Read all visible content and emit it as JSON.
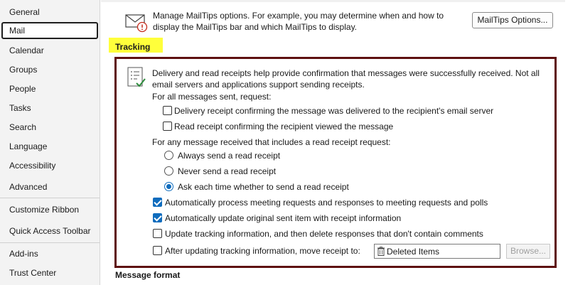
{
  "sidebar": {
    "items": [
      {
        "label": "General"
      },
      {
        "label": "Mail",
        "selected": true
      },
      {
        "label": "Calendar"
      },
      {
        "label": "Groups"
      },
      {
        "label": "People"
      },
      {
        "label": "Tasks"
      },
      {
        "label": "Search"
      },
      {
        "label": "Language"
      },
      {
        "label": "Accessibility"
      },
      {
        "label": "Advanced"
      },
      {
        "label": "Customize Ribbon"
      },
      {
        "label": "Quick Access Toolbar"
      },
      {
        "label": "Add-ins"
      },
      {
        "label": "Trust Center"
      }
    ]
  },
  "mailtips": {
    "icon": "envelope-warning-icon",
    "text": "Manage MailTips options. For example, you may determine when and how to display the MailTips bar and which MailTips to display.",
    "button_label": "MailTips Options..."
  },
  "tracking": {
    "heading": "Tracking",
    "icon": "checklist-icon",
    "description": "Delivery and read receipts help provide confirmation that messages were successfully received. Not all email servers and applications support sending receipts.",
    "sent_request_label": "For all messages sent, request:",
    "delivery_receipt": {
      "label": "Delivery receipt confirming the message was delivered to the recipient's email server",
      "checked": false
    },
    "read_receipt": {
      "label": "Read receipt confirming the recipient viewed the message",
      "checked": false
    },
    "received_label": "For any message received that includes a read receipt request:",
    "radio_options": [
      {
        "label": "Always send a read receipt",
        "selected": false
      },
      {
        "label": "Never send a read receipt",
        "selected": false
      },
      {
        "label": "Ask each time whether to send a read receipt",
        "selected": true
      }
    ],
    "auto_process": {
      "label": "Automatically process meeting requests and responses to meeting requests and polls",
      "checked": true
    },
    "auto_update": {
      "label": "Automatically update original sent item with receipt information",
      "checked": true
    },
    "update_delete": {
      "label": "Update tracking information, and then delete responses that don't contain comments",
      "checked": false
    },
    "move_receipt": {
      "label": "After updating tracking information, move receipt to:",
      "checked": false
    },
    "folder_value": "Deleted Items",
    "browse_label": "Browse...",
    "frame_color": "#5e1010",
    "heading_highlight": "#ffff3b"
  },
  "message_format": {
    "heading": "Message format"
  },
  "accent": "#0f6cbd"
}
